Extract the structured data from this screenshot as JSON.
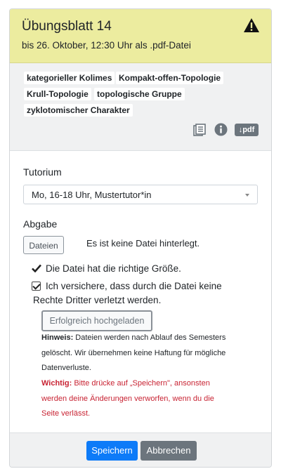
{
  "header": {
    "title": "Übungsblatt 14",
    "deadline": "bis 26. Oktober, 12:30 Uhr als .pdf-Datei",
    "warning_icon": "warning-triangle-icon"
  },
  "tags": [
    "kategorieller Kolimes",
    "Kompakt-offen-Topologie",
    "Krull-Topologie",
    "topologische Gruppe",
    "zyklotomischer Charakter"
  ],
  "tools": {
    "list_icon": "document-list-icon",
    "info_icon": "info-icon",
    "pdf_label": "↓pdf"
  },
  "form": {
    "tutorium_label": "Tutorium",
    "tutorium_value": "Mo, 16-18 Uhr, Mustertutor*in",
    "abgabe_label": "Abgabe",
    "files_button": "Dateien",
    "no_file_text": "Es ist keine Datei hinterlegt.",
    "size_ok_text": "Die Datei hat die richtige Größe.",
    "rights_line1": "Ich versichere, dass durch die Datei keine",
    "rights_line2": "Rechte Dritter verletzt werden.",
    "rights_checked": true,
    "upload_status_button": "Erfolgreich hochgeladen",
    "hint_label": "Hinweis:",
    "hint_line1": "Dateien werden nach Ablauf des Semesters",
    "hint_line2": "gelöscht. Wir übernehmen keine Haftung für mögliche",
    "hint_line3": "Datenverluste.",
    "important_label": "Wichtig:",
    "important_line1": "Bitte drücke auf „Speichern\", ansonsten",
    "important_line2": "werden deine Änderungen verworfen, wenn du die",
    "important_line3": "Seite verlässt."
  },
  "footer": {
    "save_label": "Speichern",
    "cancel_label": "Abbrechen"
  },
  "colors": {
    "header_bg": "#ecec9f",
    "primary": "#0d7bf8",
    "secondary": "#6c757d",
    "danger_text": "#c82333"
  }
}
